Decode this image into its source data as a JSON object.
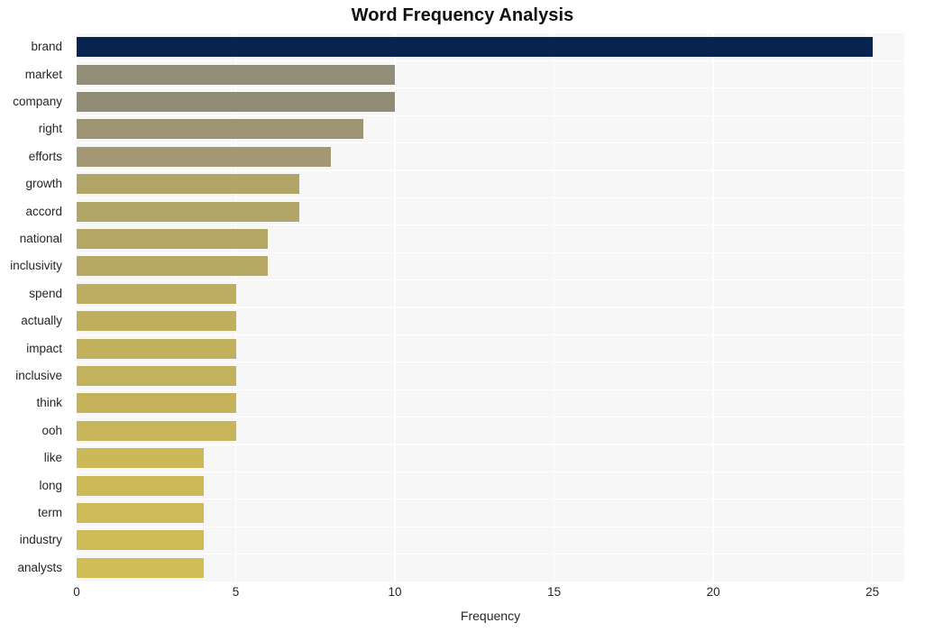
{
  "chart_data": {
    "type": "bar",
    "orientation": "horizontal",
    "title": "Word Frequency Analysis",
    "xlabel": "Frequency",
    "ylabel": "",
    "categories": [
      "brand",
      "market",
      "company",
      "right",
      "efforts",
      "growth",
      "accord",
      "national",
      "inclusivity",
      "spend",
      "actually",
      "impact",
      "inclusive",
      "think",
      "ooh",
      "like",
      "long",
      "term",
      "industry",
      "analysts"
    ],
    "values": [
      25,
      10,
      10,
      9,
      8,
      7,
      7,
      6,
      6,
      5,
      5,
      5,
      5,
      5,
      5,
      4,
      4,
      4,
      4,
      4
    ],
    "bar_colors": [
      "#06244f",
      "#938e78",
      "#918c76",
      "#9d9474",
      "#a39873",
      "#b2a568",
      "#b2a568",
      "#b4a665",
      "#b7a963",
      "#bdad60",
      "#bfaf5f",
      "#c1b05e",
      "#c3b25d",
      "#c5b35c",
      "#c7b55b",
      "#cbb859",
      "#ccb958",
      "#cdba58",
      "#cfbc57",
      "#d1bd56"
    ],
    "xlim": [
      0,
      26
    ],
    "xticks": [
      0,
      5,
      10,
      15,
      20,
      25
    ],
    "xtick_labels": [
      "0",
      "5",
      "10",
      "15",
      "20",
      "25"
    ],
    "grid": true,
    "grid_color": "#ffffff",
    "plot_background": "#f7f7f7",
    "figure_background": "#ffffff",
    "legend": "none"
  }
}
